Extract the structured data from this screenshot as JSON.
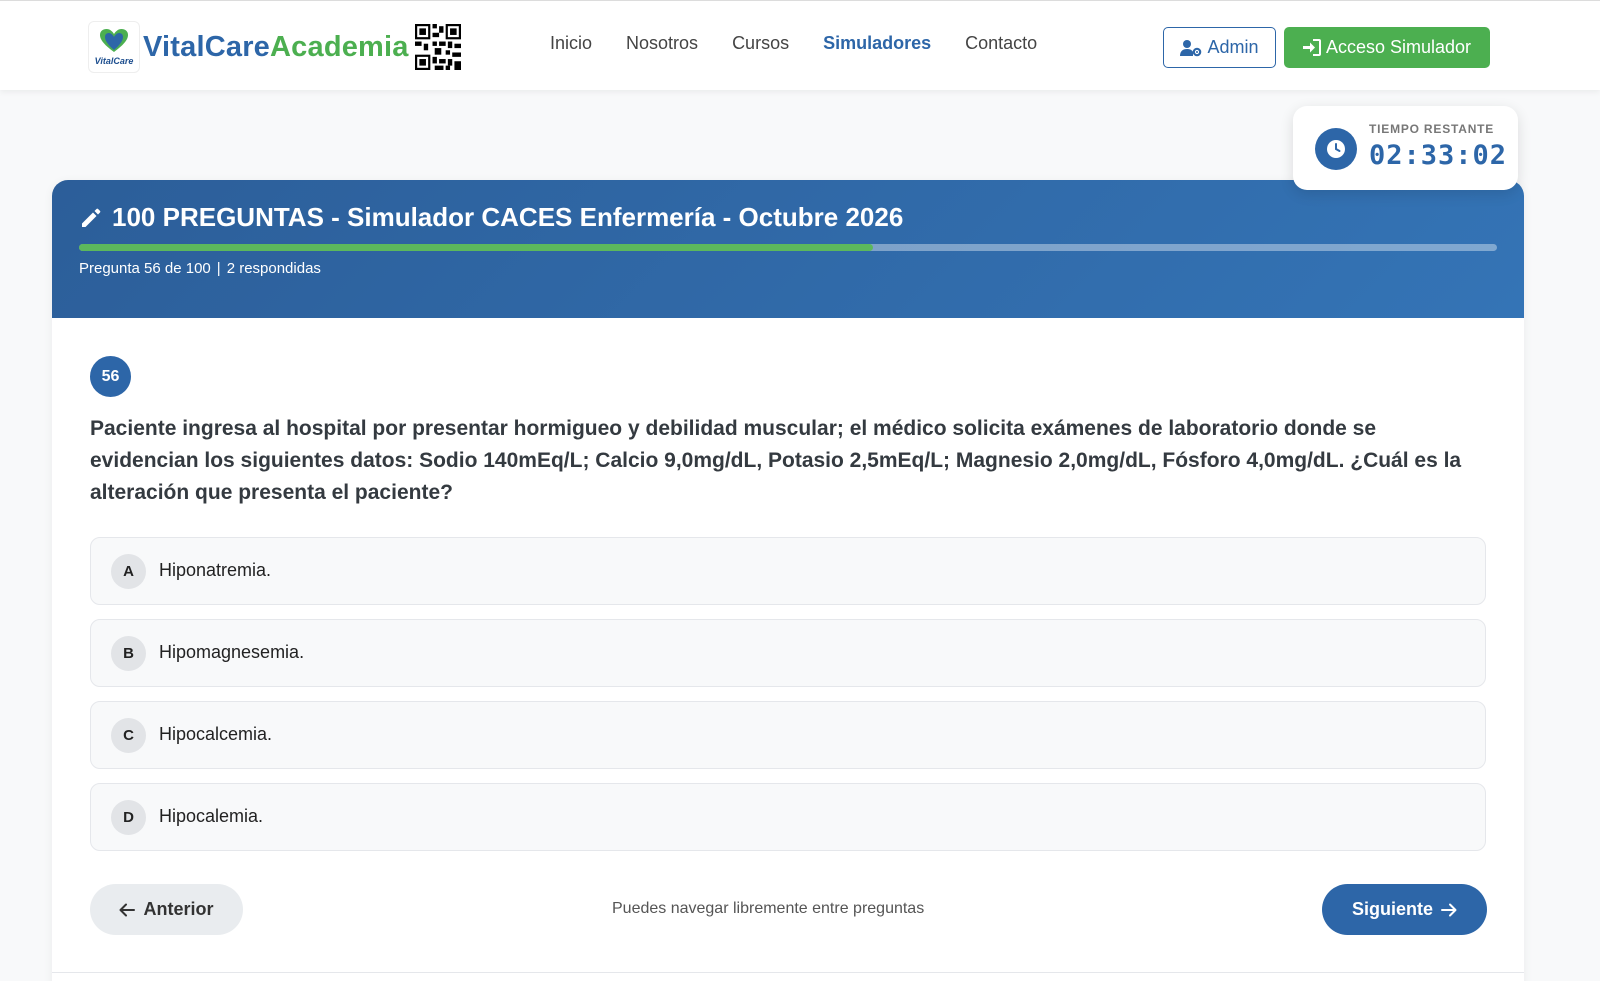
{
  "header": {
    "brand": {
      "part1": "VitalCare",
      "part2": "Academia",
      "logo_text": "VitalCare"
    },
    "nav": [
      {
        "label": "Inicio",
        "active": false
      },
      {
        "label": "Nosotros",
        "active": false
      },
      {
        "label": "Cursos",
        "active": false
      },
      {
        "label": "Simuladores",
        "active": true
      },
      {
        "label": "Contacto",
        "active": false
      }
    ],
    "admin_label": "Admin",
    "access_label": "Acceso Simulador"
  },
  "timer": {
    "label": "TIEMPO RESTANTE",
    "value": "02:33:02"
  },
  "exam": {
    "title": "100 PREGUNTAS - Simulador CACES Enfermería - Octubre 2026",
    "progress_text": "Pregunta 56 de 100",
    "answered_text": "2 respondidas",
    "progress_fraction": 0.56
  },
  "question": {
    "number": "56",
    "text": "Paciente ingresa al hospital por presentar hormigueo y debilidad muscular; el médico solicita exámenes de laboratorio donde se evidencian los siguientes datos: Sodio 140mEq/L; Calcio 9,0mg/dL, Potasio 2,5mEq/L; Magnesio 2,0mg/dL, Fósforo 4,0mg/dL. ¿Cuál es la alteración que presenta el paciente?",
    "options": [
      {
        "letter": "A",
        "text": "Hiponatremia."
      },
      {
        "letter": "B",
        "text": "Hipomagnesemia."
      },
      {
        "letter": "C",
        "text": "Hipocalcemia."
      },
      {
        "letter": "D",
        "text": "Hipocalemia."
      }
    ]
  },
  "footer_nav": {
    "prev_label": "Anterior",
    "hint": "Puedes navegar libremente entre preguntas",
    "next_label": "Siguiente"
  },
  "colors": {
    "primary": "#2d66a8",
    "accent": "#4caf50"
  },
  "icons": {
    "timer": "clock-icon",
    "title": "pencil-icon",
    "admin": "user-gear-icon",
    "access": "sign-in-icon",
    "prev": "arrow-left-icon",
    "next": "arrow-right-icon"
  }
}
